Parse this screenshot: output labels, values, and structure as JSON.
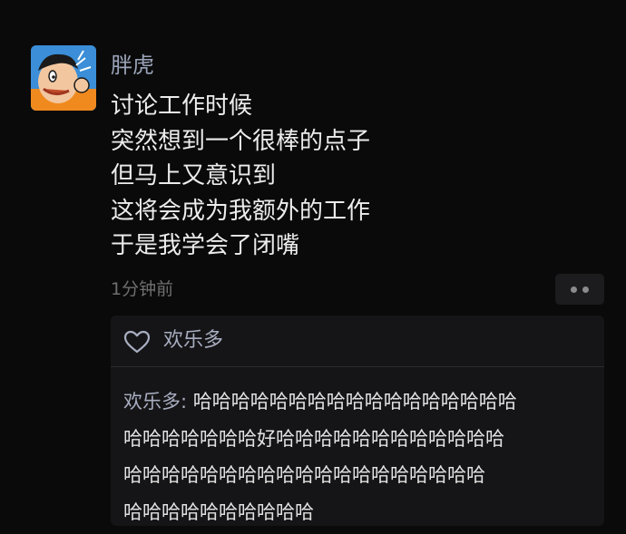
{
  "post": {
    "author": "胖虎",
    "lines": [
      "讨论工作时候",
      "突然想到一个很棒的点子",
      "但马上又意识到",
      "这将会成为我额外的工作",
      "于是我学会了闭嘴"
    ],
    "time": "1分钟前"
  },
  "likes": {
    "names": "欢乐多"
  },
  "comment": {
    "author": "欢乐多:",
    "lines": [
      "哈哈哈哈哈哈哈哈哈哈哈哈哈哈哈哈哈",
      "哈哈哈哈哈哈哈好哈哈哈哈哈哈哈哈哈哈哈哈",
      "哈哈哈哈哈哈哈哈哈哈哈哈哈哈哈哈哈哈哈",
      "哈哈哈哈哈哈哈哈哈哈"
    ]
  },
  "icons": {
    "heart": "heart-icon",
    "more": "more-icon"
  },
  "colors": {
    "background": "#0a0a0a",
    "name": "#9aa3b8",
    "panel": "#151517"
  }
}
